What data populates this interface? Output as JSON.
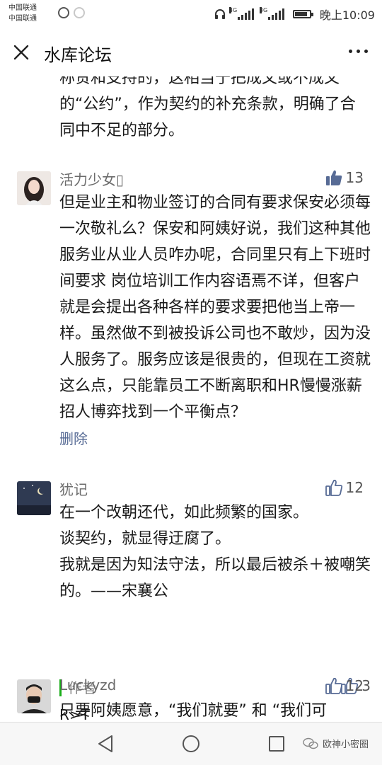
{
  "status_bar": {
    "carrier_1": "中国联通",
    "carrier_2": "中国联通",
    "net_1": "4G",
    "net_2": "3G",
    "time": "晚上10:09"
  },
  "nav": {
    "title": "水库论坛"
  },
  "previous_comment_tail": "称赞和支持的，这相当于把成文或不成文的“公约”，作为契约的补充条款，明确了合同中不足的部分。",
  "comments": [
    {
      "name": "活力少女▯",
      "likes": "13",
      "liked": true,
      "body": "但是业主和物业签订的合同有要求保安必须每一次敬礼么？保安和阿姨好说，我们这种其他服务业从业人员咋办呢，合同里只有上下班时间要求 岗位培训工作内容语焉不详，但客户就是会提出各种各样的要求要把他当上帝一样。虽然做不到被投诉公司也不敢炒，因为没人服务了。服务应该是很贵的，但现在工资就这么点，只能靠员工不断离职和HR慢慢涨薪招人博弈找到一个平衡点？",
      "delete_label": "删除"
    },
    {
      "name": "犹记",
      "likes": "12",
      "liked": false,
      "body": "在一个改朝还代，如此频繁的国家。\n谈契约，就显得迂腐了。\n我就是因为知法守法，所以最后被杀＋被嘲笑的。——宋襄公",
      "author_reply": {
        "label": "作者",
        "likes": "3",
        "text": "R>T"
      }
    },
    {
      "name": "Luckyzd",
      "likes": "12",
      "liked": false,
      "body": "只要阿姨愿意，“我们就要” 和 “我们可"
    }
  ],
  "watermark": "欧神小密圈",
  "colors": {
    "liked": "#576b95",
    "author_bar": "#1aad19",
    "link": "#576b95"
  }
}
